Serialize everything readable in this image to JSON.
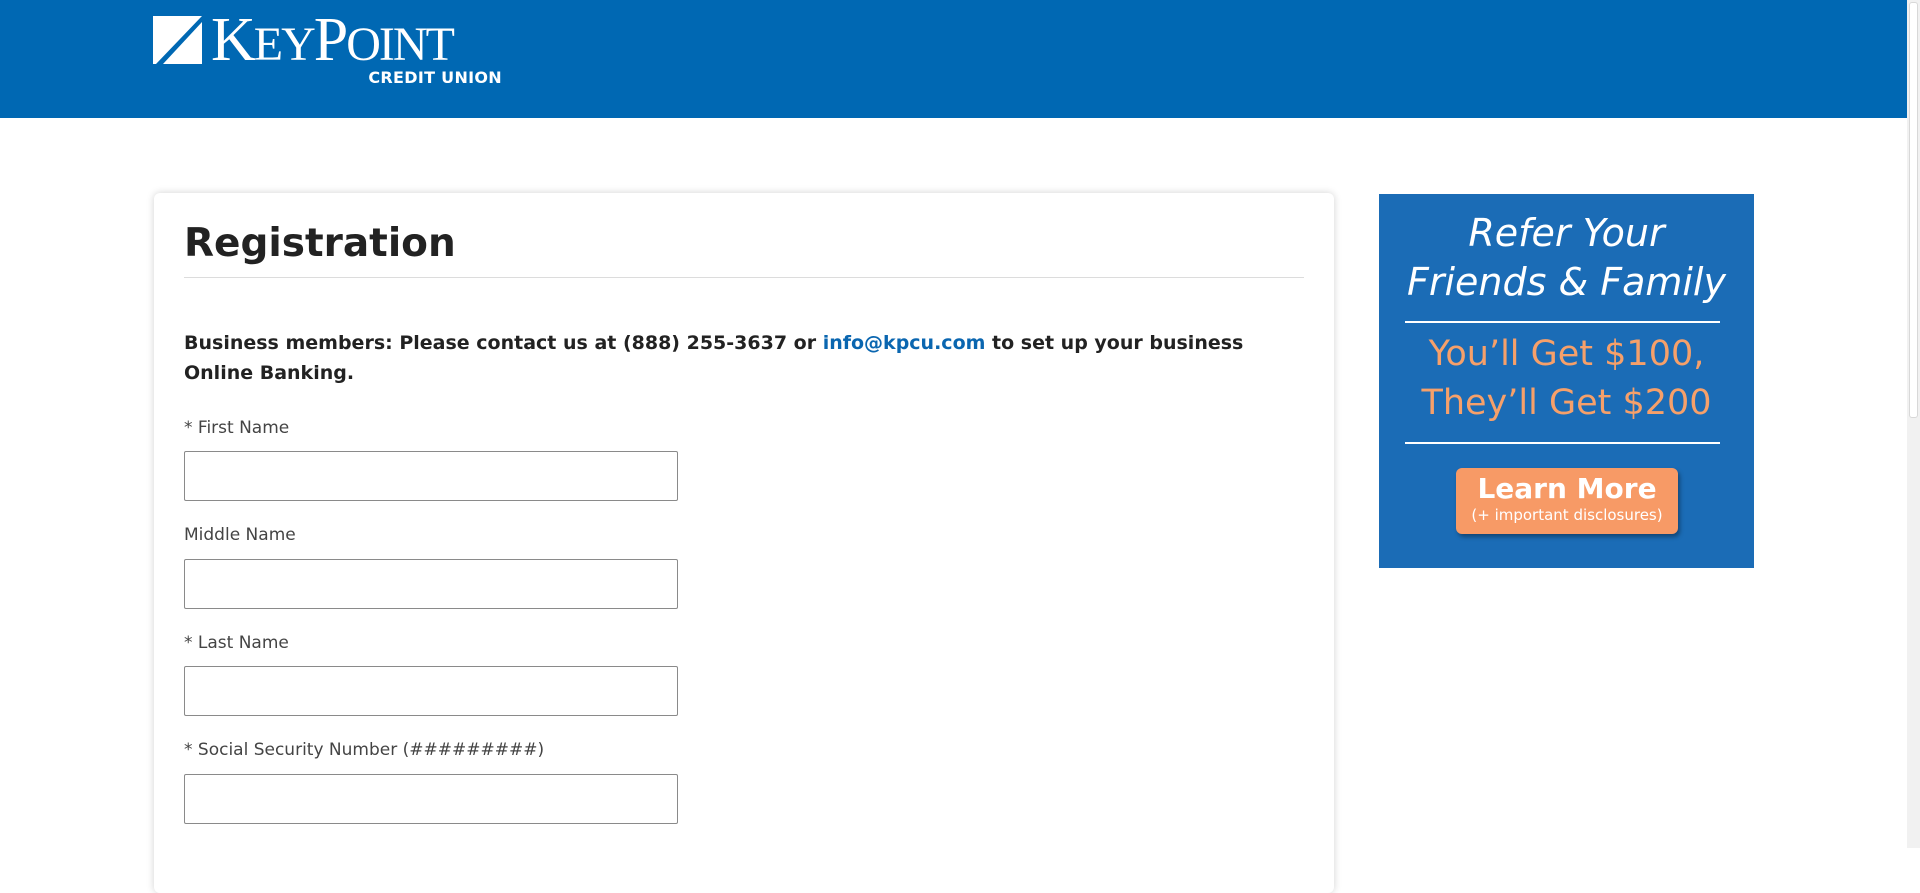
{
  "brand": {
    "name_first": "K",
    "name_middle": "EY",
    "name_second": "P",
    "name_last": "OINT",
    "subtitle": "CREDIT UNION",
    "header_color": "#0068b3"
  },
  "registration": {
    "title": "Registration",
    "notice_prefix": "Business members: Please contact us at (888) 255-3637 or ",
    "notice_email": "info@kpcu.com",
    "notice_suffix": " to set up your business Online Banking.",
    "fields": [
      {
        "label": "* First Name",
        "value": ""
      },
      {
        "label": "Middle Name",
        "value": ""
      },
      {
        "label": "* Last Name",
        "value": ""
      },
      {
        "label": "* Social Security Number (#########)",
        "value": ""
      }
    ]
  },
  "promo": {
    "heading_line1": "Refer Your",
    "heading_line2": "Friends & Family",
    "offer_line1": "You’ll Get $100,",
    "offer_line2": "They’ll Get $200",
    "button_title": "Learn More",
    "button_subtitle": "(+ important disclosures)",
    "background_color": "#1b6cb6",
    "accent_color": "#f79a66"
  }
}
